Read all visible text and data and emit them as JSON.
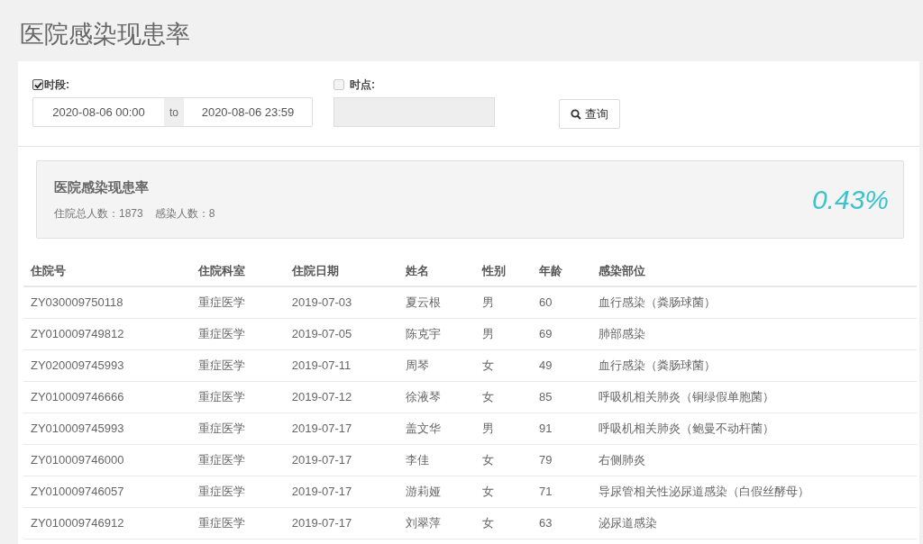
{
  "page_title": "医院感染现患率",
  "filters": {
    "period": {
      "label": "时段:",
      "checked": true,
      "from": "2020-08-06 00:00",
      "separator": "to",
      "to": "2020-08-06 23:59"
    },
    "point": {
      "label": "时点:",
      "checked": false
    },
    "search_button": "查询"
  },
  "summary": {
    "title": "医院感染现患率",
    "stats": [
      "住院总人数：1873",
      "感染人数：8"
    ],
    "rate": "0.43%"
  },
  "table": {
    "columns": [
      "住院号",
      "住院科室",
      "住院日期",
      "姓名",
      "性别",
      "年龄",
      "感染部位"
    ],
    "rows": [
      [
        "ZY030009750118",
        "重症医学",
        "2019-07-03",
        "夏云根",
        "男",
        "60",
        "血行感染（粪肠球菌）"
      ],
      [
        "ZY010009749812",
        "重症医学",
        "2019-07-05",
        "陈克宇",
        "男",
        "69",
        "肺部感染"
      ],
      [
        "ZY020009745993",
        "重症医学",
        "2019-07-11",
        "周琴",
        "女",
        "49",
        "血行感染（粪肠球菌）"
      ],
      [
        "ZY010009746666",
        "重症医学",
        "2019-07-12",
        "徐液琴",
        "女",
        "85",
        "呼吸机相关肺炎（铜绿假单胞菌）"
      ],
      [
        "ZY010009745993",
        "重症医学",
        "2019-07-17",
        "盖文华",
        "男",
        "91",
        "呼吸机相关肺炎（鲍曼不动杆菌）"
      ],
      [
        "ZY010009746000",
        "重症医学",
        "2019-07-17",
        "李佳",
        "女",
        "79",
        "右侧肺炎"
      ],
      [
        "ZY010009746057",
        "重症医学",
        "2019-07-17",
        "游莉娅",
        "女",
        "71",
        "导尿管相关性泌尿道感染（白假丝酵母）"
      ],
      [
        "ZY010009746912",
        "重症医学",
        "2019-07-17",
        "刘翠萍",
        "女",
        "63",
        "泌尿道感染"
      ]
    ]
  }
}
